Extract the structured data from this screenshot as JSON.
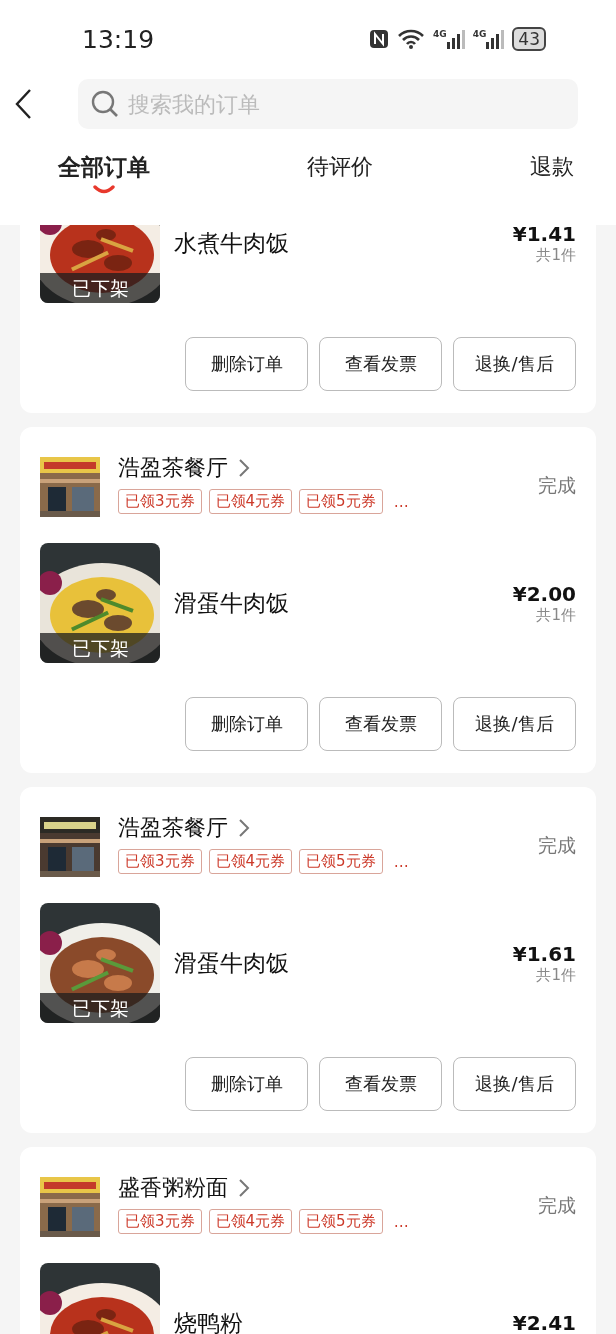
{
  "status_bar": {
    "time": "13:19",
    "network_labels": [
      "4G",
      "4G"
    ],
    "battery": "43"
  },
  "search": {
    "placeholder": "搜索我的订单"
  },
  "tabs": [
    {
      "label": "全部订单",
      "selected": true
    },
    {
      "label": "待评价",
      "selected": false
    },
    {
      "label": "退款",
      "selected": false
    }
  ],
  "orders": [
    {
      "item": {
        "name": "水煮牛肉饭",
        "badge": "已下架",
        "price": "¥1.41",
        "count": "共1件"
      },
      "buttons": [
        "删除订单",
        "查看发票",
        "退换/售后"
      ]
    },
    {
      "shop": {
        "name": "浩盈茶餐厅",
        "coupons": [
          "已领3元券",
          "已领4元券",
          "已领5元券"
        ],
        "more": "…"
      },
      "status": "完成",
      "item": {
        "name": "滑蛋牛肉饭",
        "badge": "已下架",
        "price": "¥2.00",
        "count": "共1件"
      },
      "buttons": [
        "删除订单",
        "查看发票",
        "退换/售后"
      ]
    },
    {
      "shop": {
        "name": "浩盈茶餐厅",
        "coupons": [
          "已领3元券",
          "已领4元券",
          "已领5元券"
        ],
        "more": "…"
      },
      "status": "完成",
      "item": {
        "name": "滑蛋牛肉饭",
        "badge": "已下架",
        "price": "¥1.61",
        "count": "共1件"
      },
      "buttons": [
        "删除订单",
        "查看发票",
        "退换/售后"
      ]
    },
    {
      "shop": {
        "name": "盛香粥粉面",
        "coupons": [
          "已领3元券",
          "已领4元券",
          "已领5元券"
        ],
        "more": "…"
      },
      "status": "完成",
      "item": {
        "name": "烧鸭粉",
        "price": "¥2.41"
      }
    }
  ]
}
